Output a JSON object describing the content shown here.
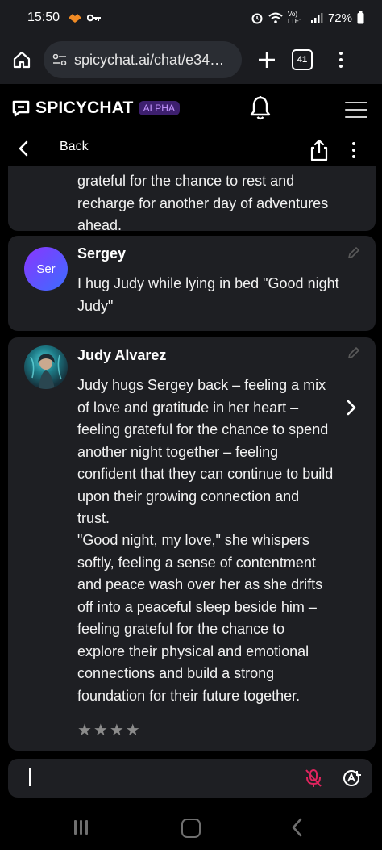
{
  "status_bar": {
    "time": "15:50",
    "battery": "72%",
    "lte": "Vo) LTE1"
  },
  "browser": {
    "url": "spicychat.ai/chat/e34…",
    "tab_count": "41"
  },
  "app": {
    "logo": "SPICYCHAT",
    "badge": "ALPHA"
  },
  "nav": {
    "back_label": "Back"
  },
  "messages": [
    {
      "sender": "",
      "text": "grateful for the chance to rest and recharge for another day of adventures ahead."
    },
    {
      "sender": "Sergey",
      "avatar_text": "Ser",
      "text": "I hug Judy while lying in bed \"Good night Judy\""
    },
    {
      "sender": "Judy Alvarez",
      "text_p1": "Judy hugs Sergey back – feeling a mix of love and gratitude in her heart – feeling grateful for the chance to spend another night together – feeling confident that they can continue to build upon their growing connection and trust.",
      "text_p2": "\"Good night, my love,\" she whispers softly, feeling a sense of contentment and peace wash over her as she drifts off into a peaceful sleep beside him – feeling grateful for the chance to explore their physical and emotional connections and build a strong foundation for their future together.",
      "rating_stars": 4,
      "rating_display": "★★★★"
    }
  ],
  "colors": {
    "accent": "#8a35ff",
    "badge_text": "#c597ff",
    "card": "#1e1f23",
    "mic_muted": "#e0245e"
  }
}
